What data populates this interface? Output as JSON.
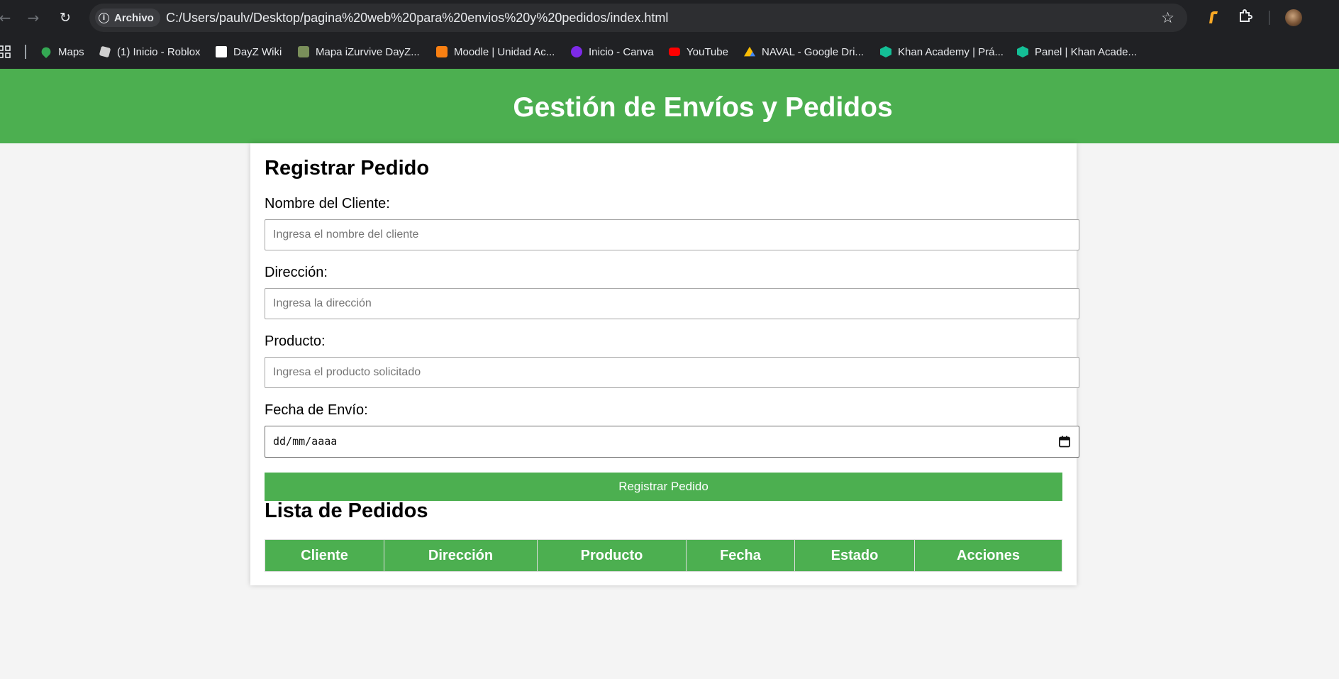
{
  "browser": {
    "site_chip": "Archivo",
    "url": "C:/Users/paulv/Desktop/pagina%20web%20para%20envios%20y%20pedidos/index.html",
    "icons": [
      "back-arrow-icon",
      "forward-arrow-icon",
      "reload-icon",
      "info-icon",
      "star-icon",
      "extension-icon",
      "puzzle-icon",
      "profile-avatar"
    ],
    "bookmarks": [
      {
        "label": "Maps",
        "icon": "maps-pin-icon",
        "color": "#34a853"
      },
      {
        "label": "(1) Inicio - Roblox",
        "icon": "roblox-icon",
        "color": "#d0d0d0"
      },
      {
        "label": "DayZ Wiki",
        "icon": "dayz-icon",
        "color": "#ffffff"
      },
      {
        "label": "Mapa iZurvive DayZ...",
        "icon": "izurvive-icon",
        "color": "#7a8f5a"
      },
      {
        "label": "Moodle | Unidad Ac...",
        "icon": "moodle-icon",
        "color": "#f98012"
      },
      {
        "label": "Inicio - Canva",
        "icon": "canva-icon",
        "color": "#7d2ae8"
      },
      {
        "label": "YouTube",
        "icon": "youtube-icon",
        "color": "#ff0000"
      },
      {
        "label": "NAVAL - Google Dri...",
        "icon": "drive-icon",
        "color": "#fbbc04"
      },
      {
        "label": "Khan Academy | Prá...",
        "icon": "khan-icon",
        "color": "#14bf96"
      },
      {
        "label": "Panel | Khan Acade...",
        "icon": "khan-icon",
        "color": "#14bf96"
      }
    ]
  },
  "page": {
    "title": "Gestión de Envíos y Pedidos",
    "accent_color": "#4caf50",
    "form": {
      "heading": "Registrar Pedido",
      "client_label": "Nombre del Cliente:",
      "client_placeholder": "Ingresa el nombre del cliente",
      "address_label": "Dirección:",
      "address_placeholder": "Ingresa la dirección",
      "product_label": "Producto:",
      "product_placeholder": "Ingresa el producto solicitado",
      "date_label": "Fecha de Envío:",
      "date_placeholder": "dd/mm/aaaa",
      "submit_label": "Registrar Pedido"
    },
    "orders": {
      "heading": "Lista de Pedidos",
      "columns": [
        "Cliente",
        "Dirección",
        "Producto",
        "Fecha",
        "Estado",
        "Acciones"
      ],
      "rows": []
    }
  }
}
